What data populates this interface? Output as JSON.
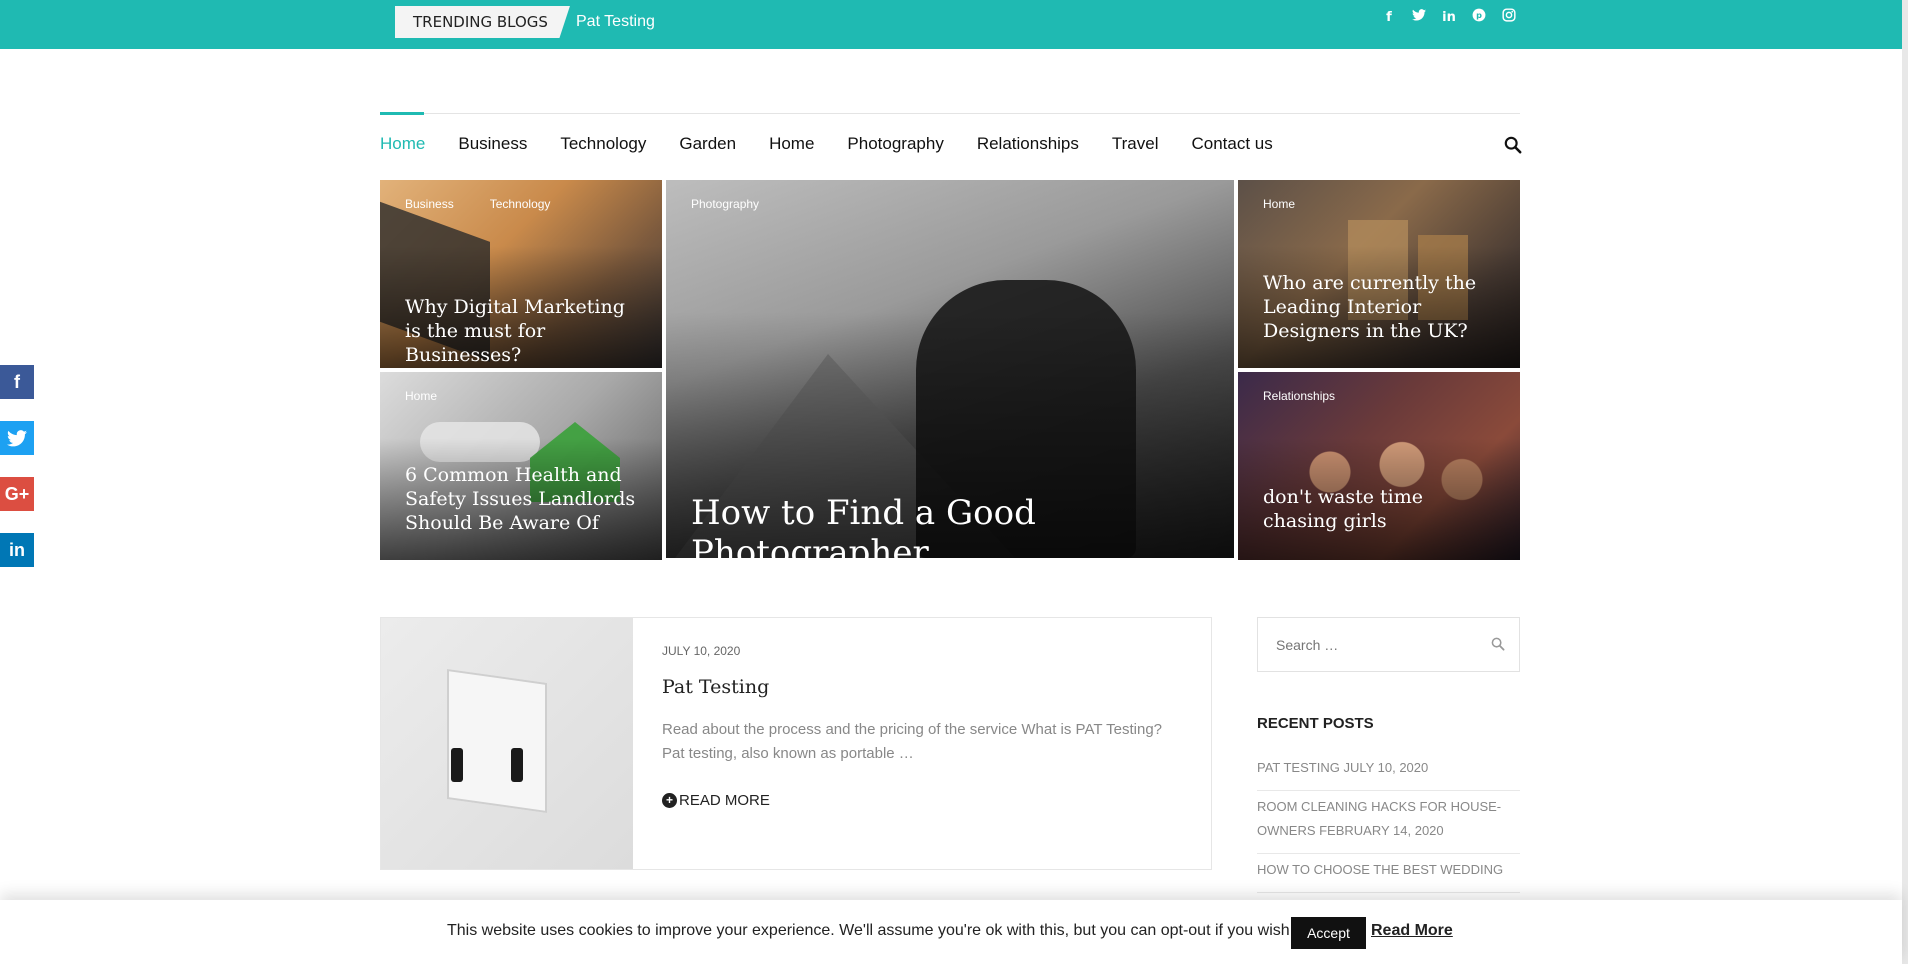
{
  "topbar": {
    "trending_label": "TRENDING BLOGS",
    "trending_link": "Pat Testing",
    "social_icons": [
      "facebook-icon",
      "twitter-icon",
      "linkedin-icon",
      "pinterest-icon",
      "instagram-icon"
    ]
  },
  "nav": {
    "items": [
      "Home",
      "Business",
      "Technology",
      "Garden",
      "Home",
      "Photography",
      "Relationships",
      "Travel",
      "Contact us"
    ],
    "active": "Home",
    "accent_color": "#1fbab2"
  },
  "hero": {
    "tiles": [
      {
        "categories": [
          "Business",
          "Technology"
        ],
        "title": "Why Digital Marketing is the must for Businesses?"
      },
      {
        "categories": [
          "Home"
        ],
        "title": "6 Common Health and Safety Issues Landlords Should Be Aware Of"
      },
      {
        "categories": [
          "Photography"
        ],
        "title": "How to Find a Good Photographer"
      },
      {
        "categories": [
          "Home"
        ],
        "title": "Who are currently the Leading Interior Designers in the UK?"
      },
      {
        "categories": [
          "Relationships"
        ],
        "title": "don't waste time chasing girls"
      }
    ]
  },
  "post": {
    "date": "JULY 10, 2020",
    "title": "Pat Testing",
    "excerpt": "Read about the process and the pricing of the service What is PAT Testing? Pat testing, also known as portable …",
    "read_more": "READ MORE"
  },
  "sidebar": {
    "search_placeholder": "Search …",
    "recent_heading": "RECENT POSTS",
    "recent_posts": [
      "PAT TESTING JULY 10, 2020",
      "ROOM CLEANING HACKS FOR HOUSE-OWNERS FEBRUARY 14, 2020",
      "HOW TO CHOOSE THE BEST WEDDING"
    ]
  },
  "share": {
    "facebook": "f",
    "twitter": "t",
    "googleplus": "G+",
    "linkedin": "in"
  },
  "cookie": {
    "text": "This website uses cookies to improve your experience. We'll assume you're ok with this, but you can opt-out if you wish.",
    "accept": "Accept",
    "read_more": "Read More"
  }
}
